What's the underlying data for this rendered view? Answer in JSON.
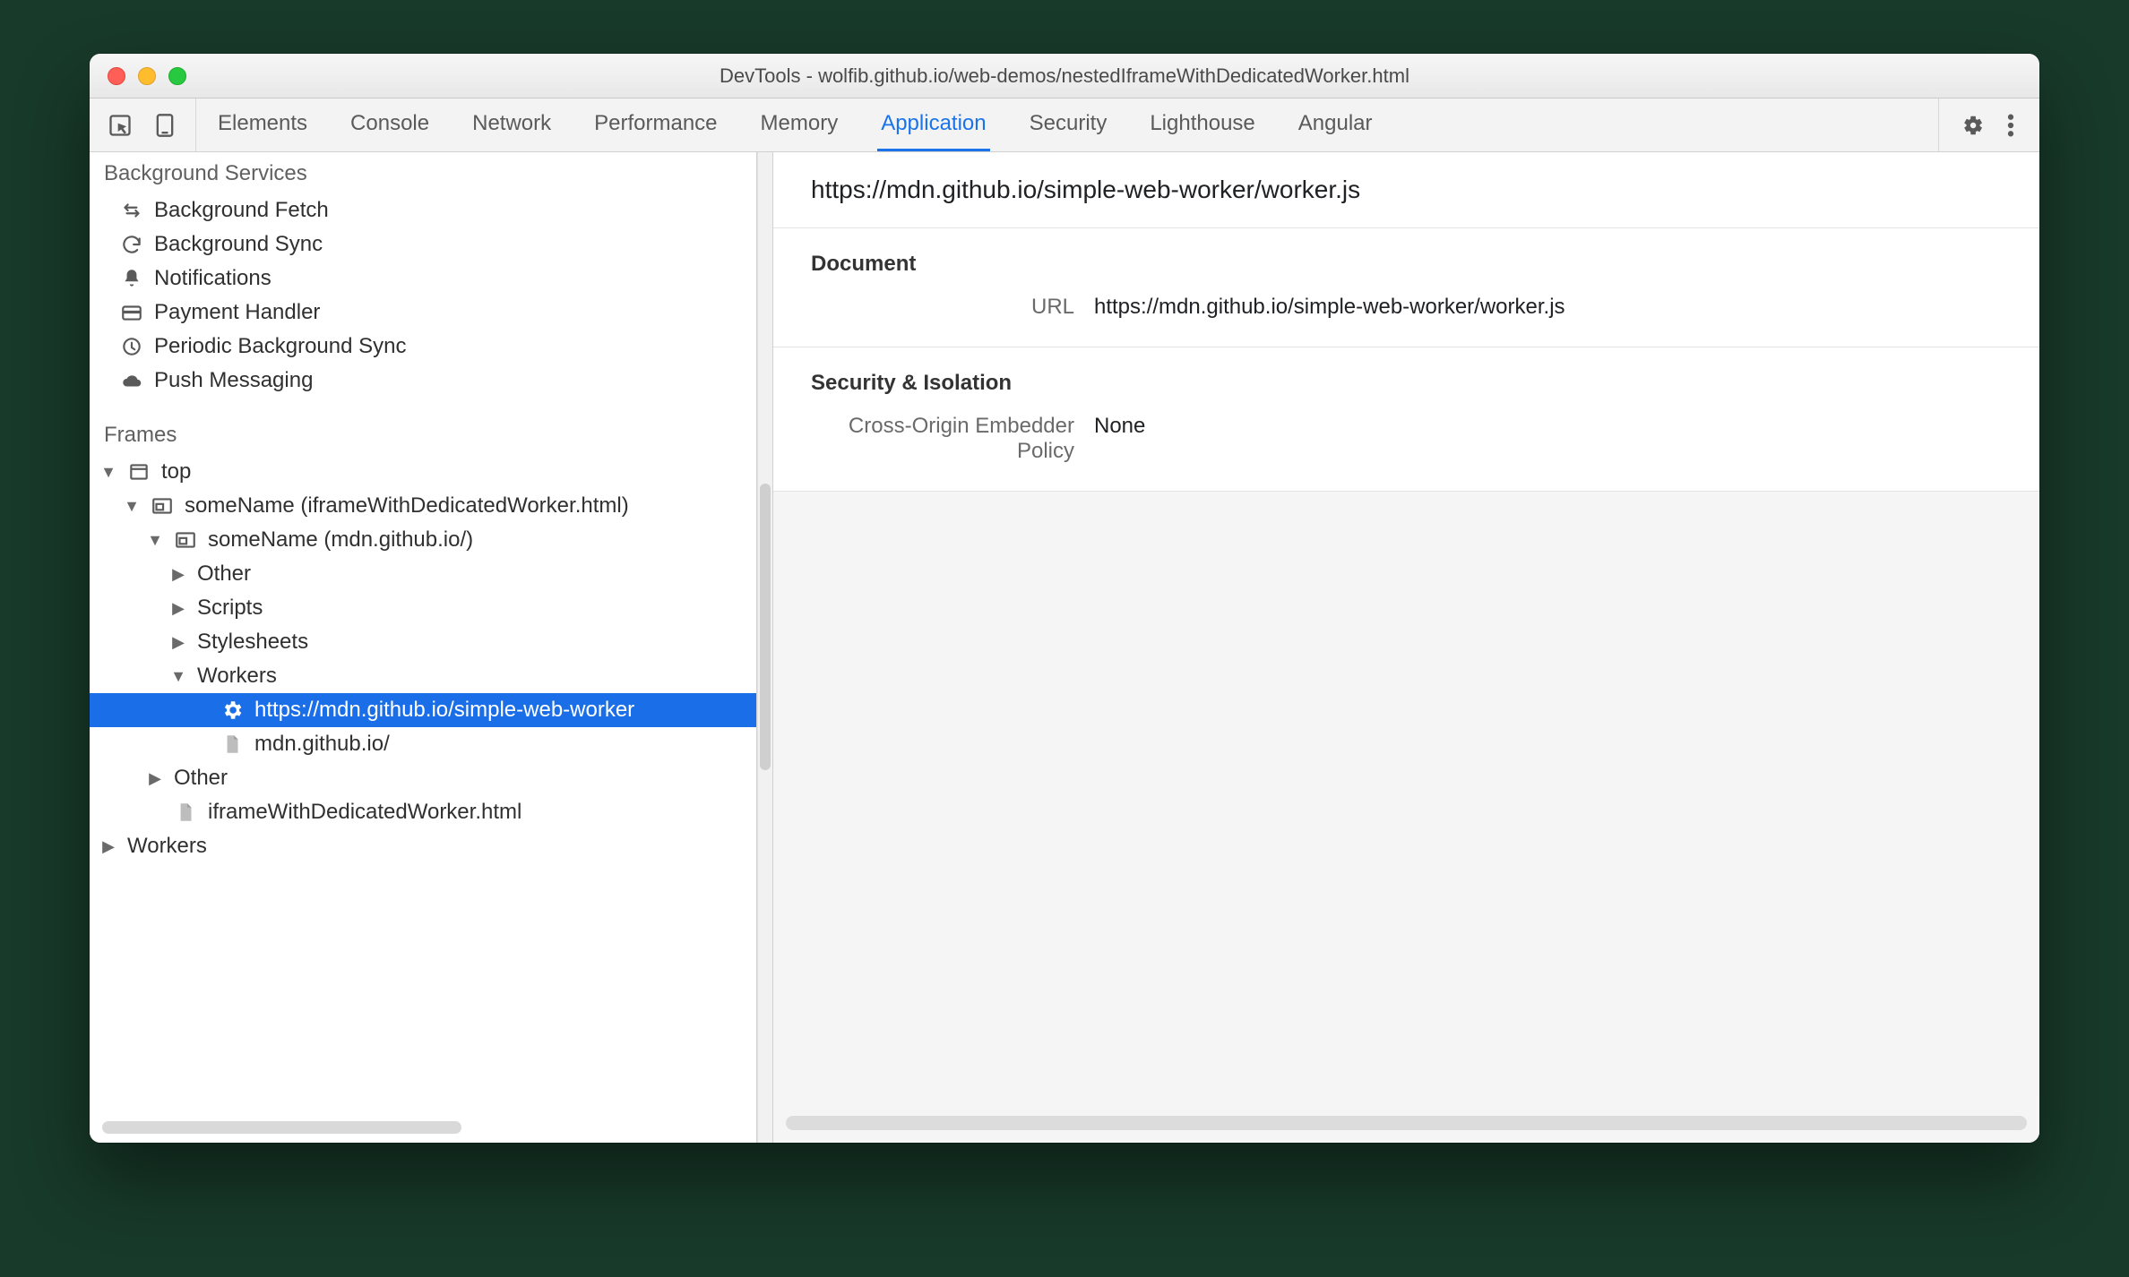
{
  "window": {
    "title": "DevTools - wolfib.github.io/web-demos/nestedIframeWithDedicatedWorker.html"
  },
  "tabs": {
    "items": [
      "Elements",
      "Console",
      "Network",
      "Performance",
      "Memory",
      "Application",
      "Security",
      "Lighthouse",
      "Angular"
    ],
    "active": "Application"
  },
  "sidebar": {
    "bg_section": "Background Services",
    "bg_items": [
      {
        "icon": "sync-alt-icon",
        "label": "Background Fetch"
      },
      {
        "icon": "refresh-icon",
        "label": "Background Sync"
      },
      {
        "icon": "bell-icon",
        "label": "Notifications"
      },
      {
        "icon": "credit-card-icon",
        "label": "Payment Handler"
      },
      {
        "icon": "clock-icon",
        "label": "Periodic Background Sync"
      },
      {
        "icon": "cloud-icon",
        "label": "Push Messaging"
      }
    ],
    "frames_section": "Frames",
    "tree": [
      {
        "indent": 0,
        "arrow": "expanded",
        "icon": "window-icon",
        "label": "top"
      },
      {
        "indent": 1,
        "arrow": "expanded",
        "icon": "iframe-icon",
        "label": "someName (iframeWithDedicatedWorker.html)"
      },
      {
        "indent": 2,
        "arrow": "expanded",
        "icon": "iframe-icon",
        "label": "someName (mdn.github.io/)"
      },
      {
        "indent": 3,
        "arrow": "collapsed",
        "icon": "",
        "label": "Other"
      },
      {
        "indent": 3,
        "arrow": "collapsed",
        "icon": "",
        "label": "Scripts"
      },
      {
        "indent": 3,
        "arrow": "collapsed",
        "icon": "",
        "label": "Stylesheets"
      },
      {
        "indent": 3,
        "arrow": "expanded",
        "icon": "",
        "label": "Workers"
      },
      {
        "indent": 4,
        "arrow": "",
        "icon": "gear-icon",
        "label": "https://mdn.github.io/simple-web-worker",
        "selected": true
      },
      {
        "indent": 4,
        "arrow": "",
        "icon": "file-icon",
        "label": "mdn.github.io/"
      },
      {
        "indent": 2,
        "arrow": "collapsed",
        "icon": "",
        "label": "Other"
      },
      {
        "indent": 2,
        "arrow": "",
        "icon": "file-icon",
        "label": "iframeWithDedicatedWorker.html"
      },
      {
        "indent": 0,
        "arrow": "collapsed",
        "icon": "",
        "label": "Workers"
      }
    ]
  },
  "main": {
    "title": "https://mdn.github.io/simple-web-worker/worker.js",
    "document_section": "Document",
    "document_url_label": "URL",
    "document_url_value": "https://mdn.github.io/simple-web-worker/worker.js",
    "security_section": "Security & Isolation",
    "coep_label": "Cross-Origin Embedder Policy",
    "coep_value": "None"
  }
}
